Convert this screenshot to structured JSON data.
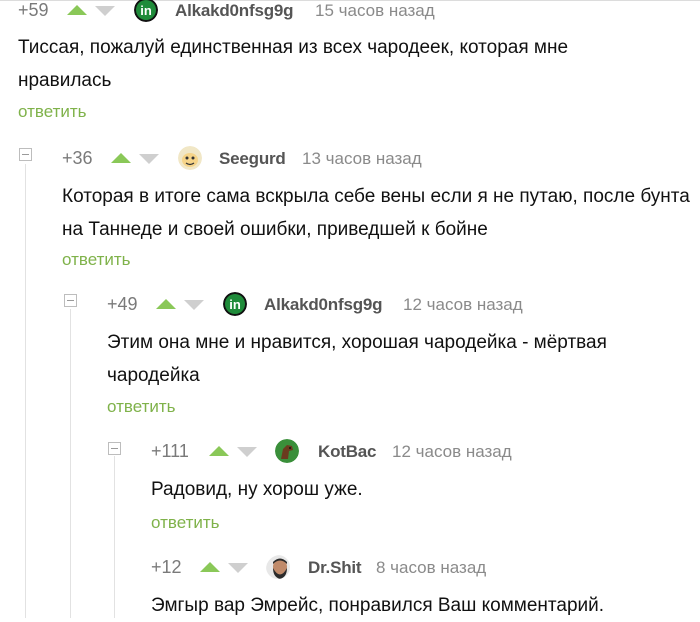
{
  "comments": [
    {
      "score": "+59",
      "username": "Alkakd0nfsg9g",
      "time": "15 часов назад",
      "avatar_icon": "green-circle-in-icon",
      "text": "Тиссая, пожалуй единственная из всех чародеек, которая мне нравилась",
      "reply": "ответить"
    },
    {
      "score": "+36",
      "username": "Seegurd",
      "time": "13 часов назад",
      "avatar_icon": "cartoon-face-icon",
      "text": "Которая в итоге сама вскрыла себе вены если я не путаю, после бунта на Таннеде и своей ошибки, приведшей к бойне",
      "reply": "ответить"
    },
    {
      "score": "+49",
      "username": "Alkakd0nfsg9g",
      "time": "12 часов назад",
      "avatar_icon": "green-circle-in-icon",
      "text": "Этим она мне и нравится, хорошая чародейка - мёртвая чародейка",
      "reply": "ответить"
    },
    {
      "score": "+111",
      "username": "KotBac",
      "time": "12 часов назад",
      "avatar_icon": "horse-icon",
      "text": "Радовид, ну хорош уже.",
      "reply": "ответить"
    },
    {
      "score": "+12",
      "username": "Dr.Shit",
      "time": "8 часов назад",
      "avatar_icon": "bearded-man-icon",
      "text": "Эмгыр вар Эмрейс, понравился Ваш комментарий."
    }
  ]
}
